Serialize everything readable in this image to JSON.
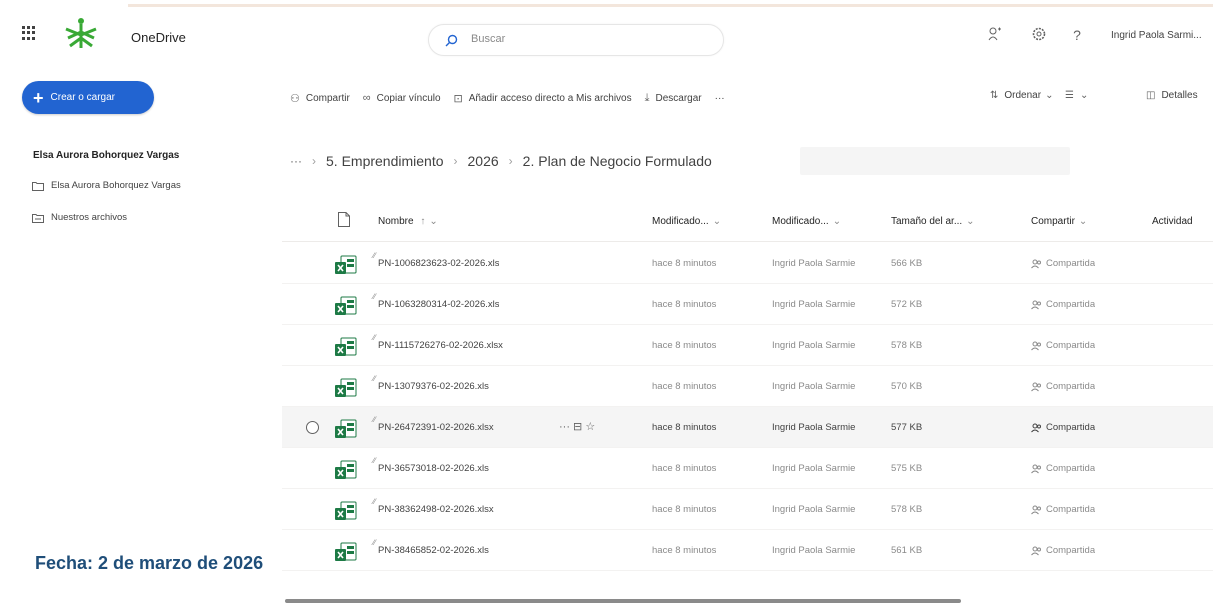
{
  "header": {
    "app_name": "OneDrive",
    "search_placeholder": "Buscar",
    "user_name": "Ingrid Paola Sarmi..."
  },
  "nav": {
    "create_label": "Crear o cargar",
    "heading": "Elsa Aurora Bohorquez Vargas",
    "items": [
      {
        "label": "Elsa Aurora Bohorquez Vargas",
        "icon": "folder-icon"
      },
      {
        "label": "Nuestros archivos",
        "icon": "shared-folder-icon"
      }
    ]
  },
  "commands": {
    "share": "Compartir",
    "copy_link": "Copiar vínculo",
    "add_shortcut": "Añadir acceso directo a Mis archivos",
    "download": "Descargar",
    "more": "···",
    "sort": "Ordenar",
    "details": "Detalles"
  },
  "breadcrumb": {
    "overflow": "···",
    "items": [
      "5. Emprendimiento",
      "2026",
      "2. Plan de Negocio Formulado"
    ]
  },
  "columns": {
    "name": "Nombre",
    "name_sort": "↑",
    "modified": "Modificado...",
    "modified_by": "Modificado...",
    "size": "Tamaño del ar...",
    "sharing": "Compartir",
    "activity": "Actividad"
  },
  "files": [
    {
      "name": "PN-1006823623-02-2026.xls",
      "modified": "hace 8 minutos",
      "modified_by": "Ingrid Paola Sarmie",
      "size": "566 KB",
      "sharing": "Compartida"
    },
    {
      "name": "PN-1063280314-02-2026.xls",
      "modified": "hace 8 minutos",
      "modified_by": "Ingrid Paola Sarmie",
      "size": "572 KB",
      "sharing": "Compartida"
    },
    {
      "name": "PN-1115726276-02-2026.xlsx",
      "modified": "hace 8 minutos",
      "modified_by": "Ingrid Paola Sarmie",
      "size": "578 KB",
      "sharing": "Compartida"
    },
    {
      "name": "PN-13079376-02-2026.xls",
      "modified": "hace 8 minutos",
      "modified_by": "Ingrid Paola Sarmie",
      "size": "570 KB",
      "sharing": "Compartida"
    },
    {
      "name": "PN-26472391-02-2026.xlsx",
      "modified": "hace 8 minutos",
      "modified_by": "Ingrid Paola Sarmie",
      "size": "577 KB",
      "sharing": "Compartida"
    },
    {
      "name": "PN-36573018-02-2026.xls",
      "modified": "hace 8 minutos",
      "modified_by": "Ingrid Paola Sarmie",
      "size": "575 KB",
      "sharing": "Compartida"
    },
    {
      "name": "PN-38362498-02-2026.xlsx",
      "modified": "hace 8 minutos",
      "modified_by": "Ingrid Paola Sarmie",
      "size": "578 KB",
      "sharing": "Compartida"
    },
    {
      "name": "PN-38465852-02-2026.xls",
      "modified": "hace 8 minutos",
      "modified_by": "Ingrid Paola Sarmie",
      "size": "561 KB",
      "sharing": "Compartida"
    }
  ],
  "row_actions": "··· ⊟ ☆",
  "overlay": {
    "date_text": "Fecha: 2 de marzo de 2026"
  },
  "colors": {
    "accent": "#2264d1",
    "excel_green": "#1d7a45",
    "overlay_text": "#1f4e79"
  }
}
